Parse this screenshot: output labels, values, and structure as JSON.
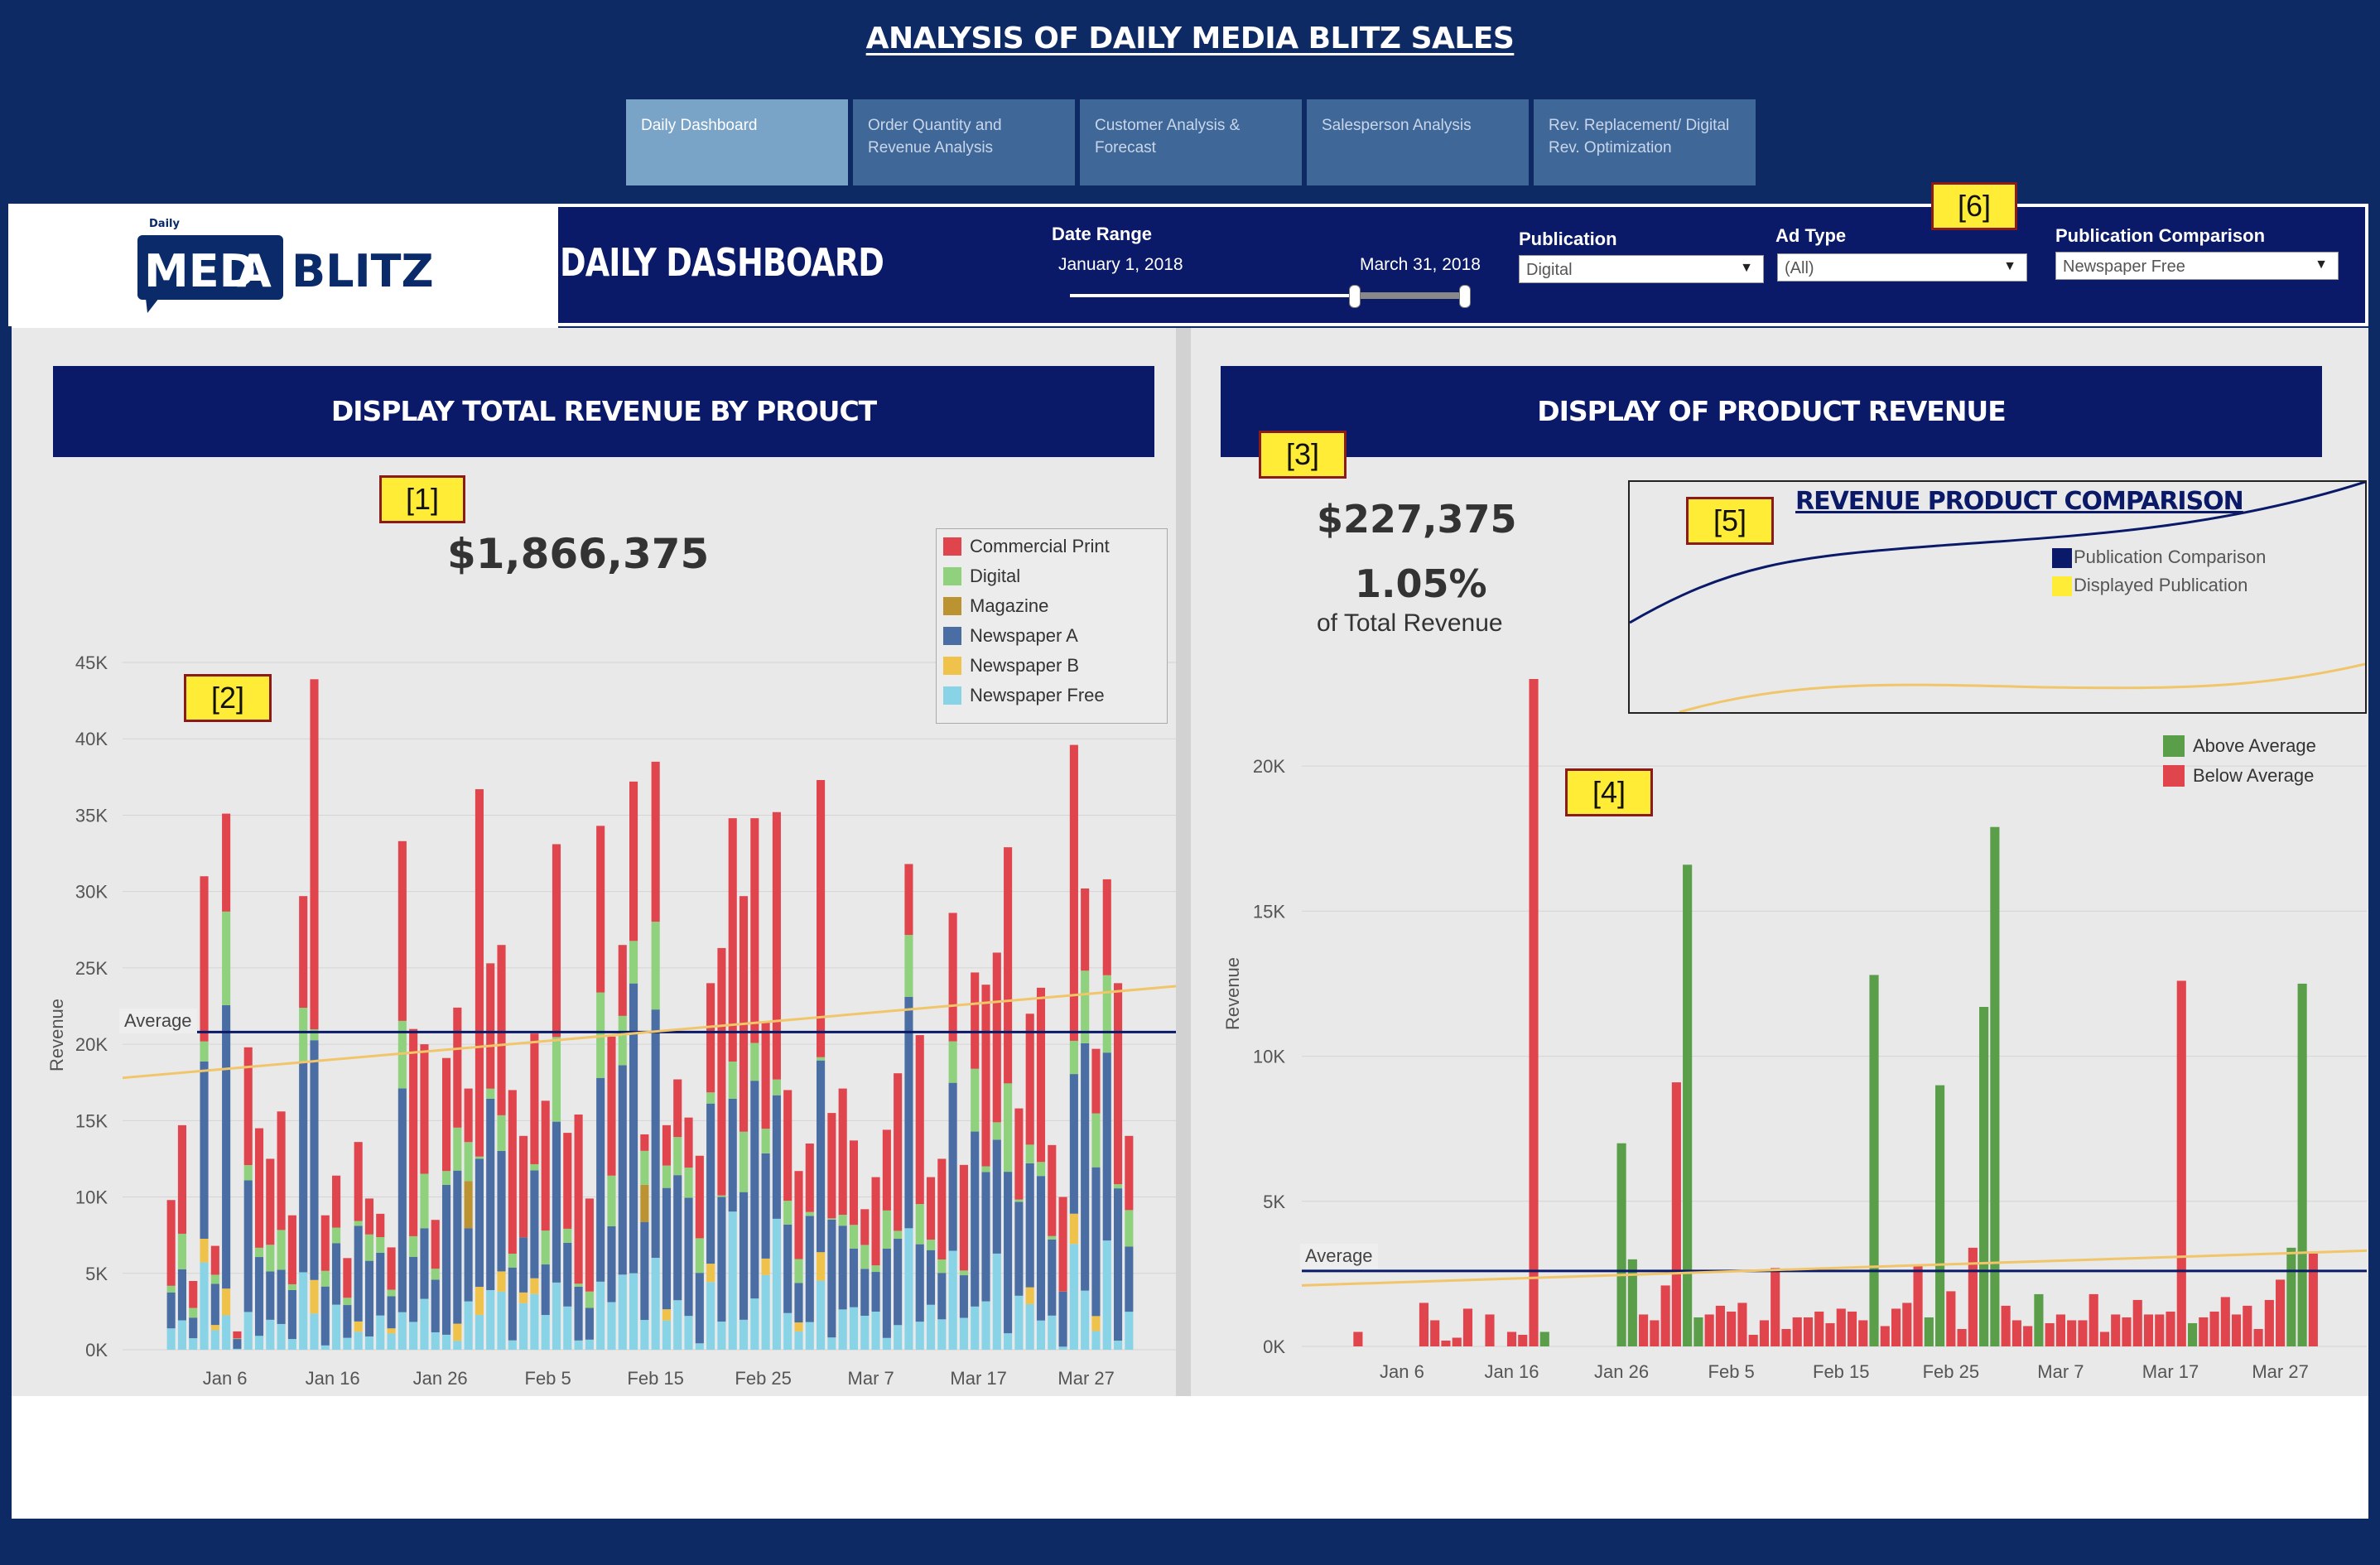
{
  "app": {
    "title": "ANALYSIS OF DAILY MEDIA BLITZ SALES"
  },
  "tabs": [
    {
      "line1": "Daily Dashboard",
      "line2": ""
    },
    {
      "line1": "Order Quantity and",
      "line2": "Revenue Analysis"
    },
    {
      "line1": "Customer Analysis &",
      "line2": "Forecast"
    },
    {
      "line1": "Salesperson Analysis",
      "line2": ""
    },
    {
      "line1": "Rev. Replacement/ Digital",
      "line2": "Rev. Optimization"
    }
  ],
  "header": {
    "logo_small": "Daily",
    "logo_left": "MED",
    "logo_mid": "A",
    "logo_right": "BLITZ",
    "dashboard_title": "DAILY DASHBOARD",
    "date_range_label": "Date Range",
    "date_start": "January 1, 2018",
    "date_end": "March 31, 2018",
    "date_slider_start": 0.72,
    "date_slider_end": 1.0,
    "publication_label": "Publication",
    "publication_value": "Digital",
    "adtype_label": "Ad Type",
    "adtype_value": "(All)",
    "pubcomp_label": "Publication Comparison",
    "pubcomp_value": "Newspaper Free"
  },
  "markers": {
    "m1": "[1]",
    "m2": "[2]",
    "m3": "[3]",
    "m4": "[4]",
    "m5": "[5]",
    "m6": "[6]"
  },
  "colors": {
    "commercial_print": "#e0454e",
    "digital": "#8fd17c",
    "magazine": "#bb9431",
    "newspaper_a": "#4a6ea3",
    "newspaper_b": "#eec24b",
    "newspaper_free": "#88d3e6",
    "above_avg": "#5a9e4a",
    "below_avg": "#e0454e",
    "avg_line": "#0a1a68",
    "trend_line": "#f1c56a"
  },
  "left_panel": {
    "title": "DISPLAY TOTAL REVENUE BY PROUCT",
    "total_revenue": "$1,866,375",
    "average_label": "Average",
    "ylabel": "Revenue",
    "legend": [
      "Commercial Print",
      "Digital",
      "Magazine",
      "Newspaper A",
      "Newspaper B",
      "Newspaper Free"
    ],
    "yticks": [
      "0K",
      "5K",
      "10K",
      "15K",
      "20K",
      "25K",
      "30K",
      "35K",
      "40K",
      "45K"
    ],
    "xticks": [
      "Jan 6",
      "Jan 16",
      "Jan 26",
      "Feb 5",
      "Feb 15",
      "Feb 25",
      "Mar 7",
      "Mar 17",
      "Mar 27"
    ]
  },
  "right_panel": {
    "title": "DISPLAY OF PRODUCT REVENUE",
    "revenue": "$227,375",
    "pct": "1.05%",
    "pct_label": "of Total Revenue",
    "average_label": "Average",
    "ylabel": "Revenue",
    "legend": [
      "Above Average",
      "Below Average"
    ],
    "yticks": [
      "0K",
      "5K",
      "10K",
      "15K",
      "20K"
    ],
    "xticks": [
      "Jan 6",
      "Jan 16",
      "Jan 26",
      "Feb 5",
      "Feb 15",
      "Feb 25",
      "Mar 7",
      "Mar 17",
      "Mar 27"
    ],
    "comparison_title": "REVENUE PRODUCT COMPARISON",
    "comparison_legend": [
      "Publication Comparison",
      "Displayed Publication"
    ]
  },
  "chart_data": [
    {
      "type": "bar",
      "stacked": true,
      "title": "DISPLAY TOTAL REVENUE BY PROUCT",
      "xlabel": "",
      "ylabel": "Revenue",
      "ylim": [
        0,
        45000
      ],
      "x_start": "2018-01-01",
      "x_end": "2018-03-31",
      "average": 20800,
      "trend": [
        17800,
        23800
      ],
      "grid": true,
      "legend_position": "top-right",
      "series_order": [
        "Newspaper Free",
        "Newspaper B",
        "Newspaper A",
        "Magazine",
        "Digital",
        "Commercial Print"
      ],
      "totals": [
        9800,
        14700,
        4500,
        31000,
        6800,
        35100,
        1200,
        19800,
        14500,
        12500,
        15600,
        8800,
        29700,
        43900,
        8800,
        11400,
        6000,
        13600,
        9900,
        8900,
        6700,
        33300,
        21000,
        20000,
        8500,
        19100,
        22400,
        17100,
        36700,
        25300,
        26500,
        17000,
        14000,
        20700,
        16300,
        33100,
        14200,
        15400,
        9900,
        34300,
        20500,
        26500,
        37200,
        14100,
        38500,
        14700,
        17700,
        15200,
        12700,
        24000,
        26300,
        34800,
        29700,
        34800,
        21500,
        35200,
        17000,
        11700,
        13500,
        37300,
        15500,
        17100,
        13700,
        9200,
        11300,
        14400,
        18100,
        31800,
        20600,
        11300,
        12500,
        28600,
        12100,
        24700,
        23900,
        26000,
        32900,
        15800,
        22000,
        23700,
        13400,
        10000,
        39600,
        30200,
        19700,
        30800,
        24000,
        14000
      ]
    },
    {
      "type": "bar",
      "title": "DISPLAY OF PRODUCT REVENUE",
      "ylabel": "Revenue",
      "ylim": [
        0,
        23000
      ],
      "x_start": "2018-01-01",
      "x_end": "2018-03-31",
      "average": 2600,
      "trend": [
        2100,
        3300
      ],
      "series": [
        {
          "name": "Above Average",
          "days": [
            18,
            25,
            26,
            31,
            32,
            48,
            53,
            54,
            58,
            59,
            63,
            77,
            86,
            87
          ]
        },
        {
          "name": "Below Average",
          "days": "all other days"
        }
      ],
      "values": [
        0,
        500,
        0,
        0,
        0,
        0,
        0,
        1500,
        900,
        200,
        300,
        1300,
        0,
        1100,
        0,
        500,
        400,
        23000,
        500,
        0,
        0,
        0,
        0,
        0,
        0,
        7000,
        3000,
        1100,
        900,
        2100,
        9100,
        16600,
        1000,
        1100,
        1400,
        1200,
        1500,
        400,
        900,
        2700,
        600,
        1000,
        1000,
        1200,
        800,
        1300,
        1200,
        900,
        12800,
        700,
        1300,
        1500,
        2800,
        1000,
        9000,
        1900,
        600,
        3400,
        11700,
        17900,
        1400,
        900,
        700,
        1800,
        800,
        1100,
        900,
        900,
        1800,
        500,
        1100,
        1000,
        1600,
        1100,
        1100,
        1200,
        12600,
        800,
        1000,
        1200,
        1700,
        1100,
        1400,
        600,
        1600,
        2300,
        3400,
        12500,
        3200
      ]
    },
    {
      "type": "line",
      "title": "REVENUE PRODUCT COMPARISON",
      "series": [
        {
          "name": "Publication Comparison",
          "trend": "rising"
        },
        {
          "name": "Displayed Publication",
          "trend": "flat-slightly-rising"
        }
      ]
    }
  ]
}
